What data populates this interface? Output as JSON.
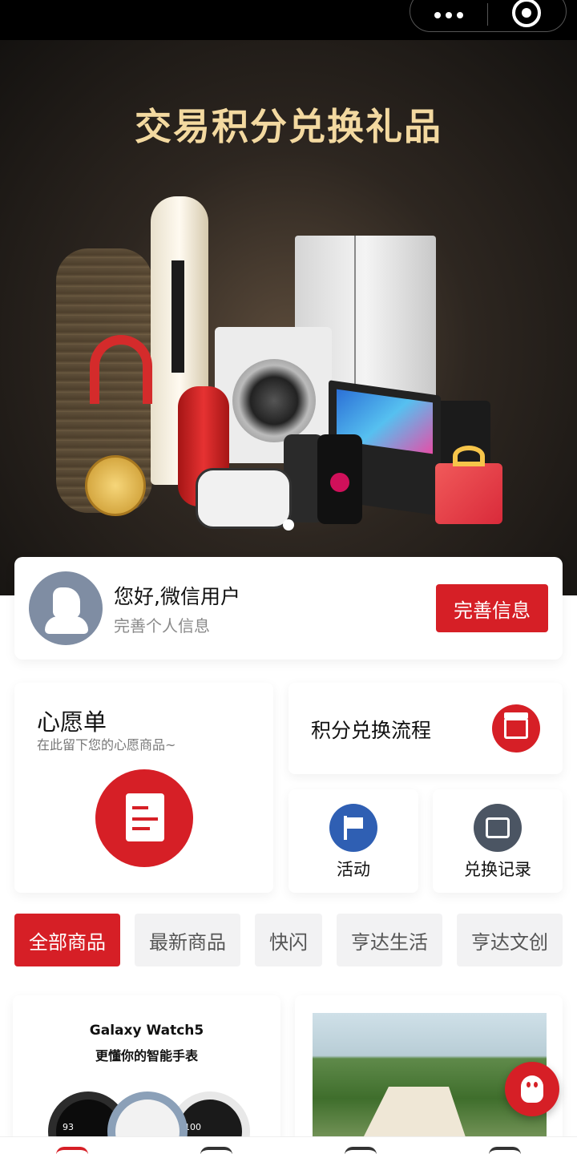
{
  "banner": {
    "title": "交易积分兑换礼品",
    "slides": 1,
    "active_slide": 1
  },
  "user": {
    "greeting": "您好,微信用户",
    "subtitle": "完善个人信息",
    "action_label": "完善信息"
  },
  "wishlist": {
    "title": "心愿单",
    "subtitle": "在此留下您的心愿商品~"
  },
  "exchange_flow": {
    "label": "积分兑换流程"
  },
  "shortcuts": [
    {
      "label": "活动",
      "icon": "flag-icon",
      "color": "#2f5fb3"
    },
    {
      "label": "兑换记录",
      "icon": "record-icon",
      "color": "#4b5563"
    }
  ],
  "categories": [
    "全部商品",
    "最新商品",
    "快闪",
    "亨达生活",
    "亨达文创"
  ],
  "active_category": "全部商品",
  "products": [
    {
      "brand": "Galaxy Watch5",
      "slogan": "更懂你的智能手表",
      "watch_readouts": [
        "93",
        "100"
      ]
    },
    {
      "image": "camping-tent-photo"
    }
  ],
  "colors": {
    "accent": "#d61f26",
    "activity_icon": "#2f5fb3",
    "record_icon": "#4b5563"
  },
  "fab": {
    "icon": "qq-icon"
  }
}
